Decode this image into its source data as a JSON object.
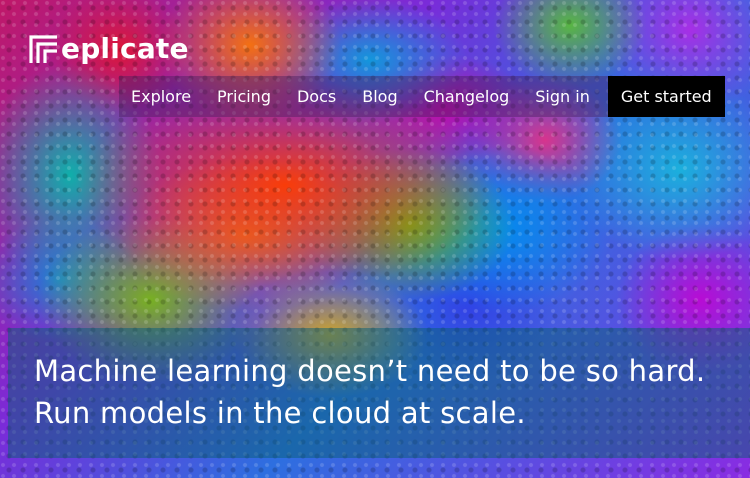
{
  "brand": {
    "name": "replicate",
    "text": "eplicate"
  },
  "nav": {
    "links": [
      "Explore",
      "Pricing",
      "Docs",
      "Blog",
      "Changelog",
      "Sign in"
    ],
    "cta": "Get started"
  },
  "hero": {
    "line1": "Machine learning doesn’t need to be so hard.",
    "line2": "Run models in the cloud at scale."
  },
  "colors": {
    "cta_background": "#000000",
    "text": "#ffffff"
  }
}
